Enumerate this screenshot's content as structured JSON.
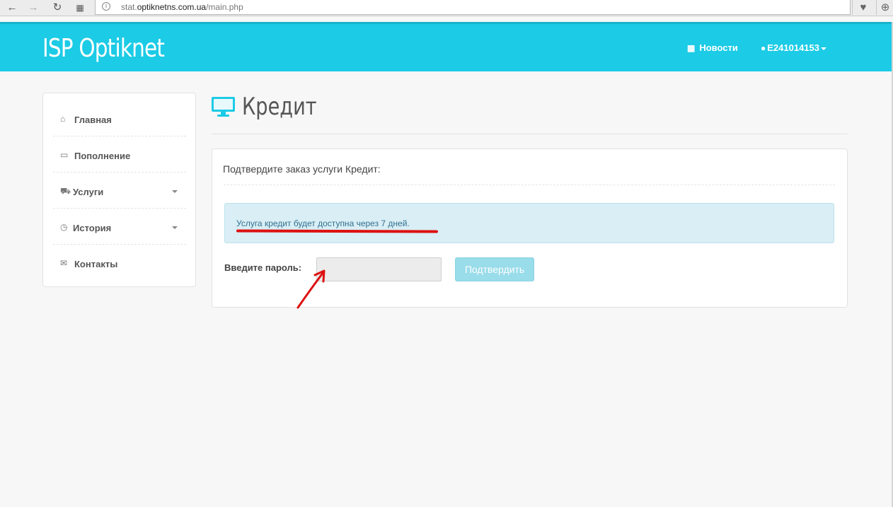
{
  "browser": {
    "url_prefix": "stat.",
    "url_domain": "optiknetns.com.ua",
    "url_path": "/main.php"
  },
  "header": {
    "brand": "ISP Optiknet",
    "news_label": "Новости",
    "user_label": "E241014153"
  },
  "sidebar": {
    "items": [
      {
        "label": "Главная",
        "icon": "home-icon"
      },
      {
        "label": "Пополнение",
        "icon": "money-icon"
      },
      {
        "label": "Услуги",
        "icon": "cart-icon"
      },
      {
        "label": "История",
        "icon": "clock-icon"
      },
      {
        "label": "Контакты",
        "icon": "envelope-icon"
      }
    ]
  },
  "main": {
    "title": "Кредит",
    "panel_heading": "Подтвердите заказ услуги Кредит:",
    "alert_text": "Услуга кредит будет доступна через 7 дней.",
    "password_label": "Введите пароль:",
    "password_value": "",
    "confirm_label": "Подтвердить"
  },
  "colors": {
    "header_bg": "#1ccbe6",
    "alert_bg": "#d9eef5",
    "alert_text": "#31708f",
    "annotation_red": "#dd1111",
    "button_disabled": "#99dcea"
  }
}
